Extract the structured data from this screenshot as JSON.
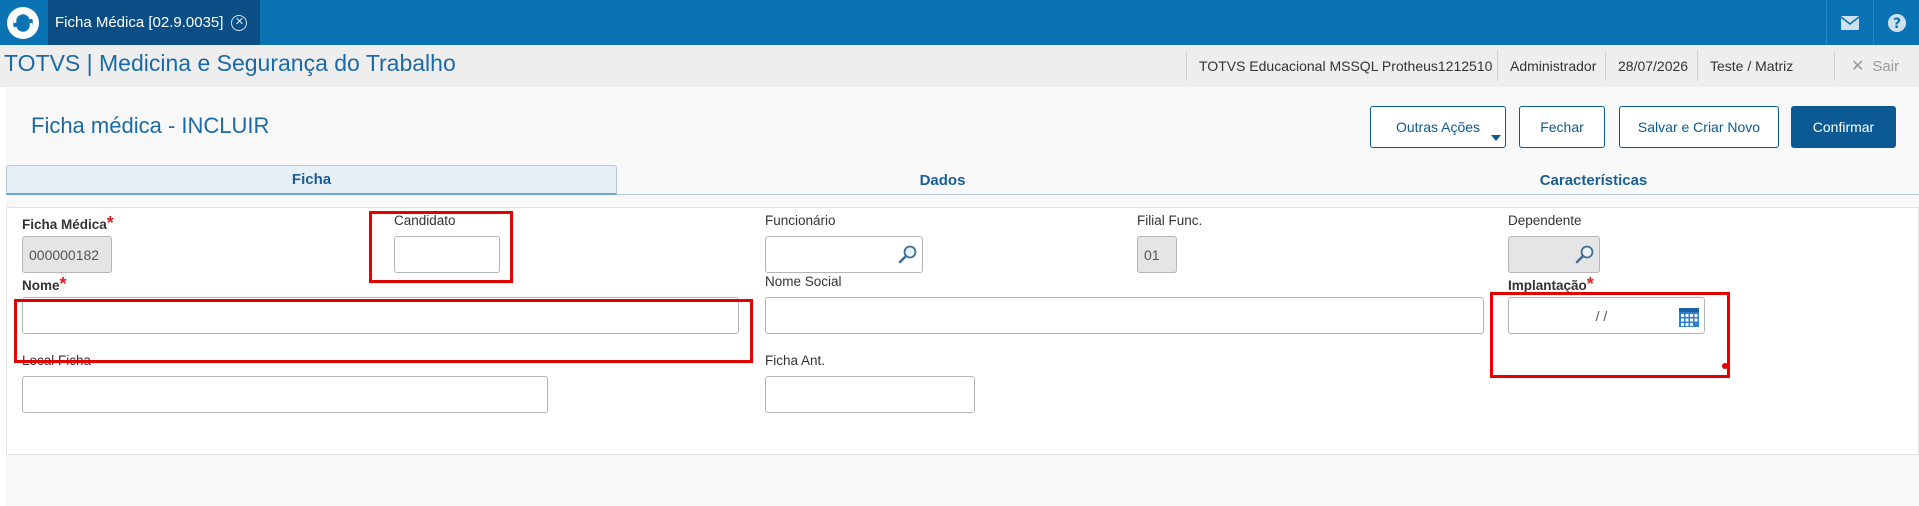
{
  "topbar": {
    "tab_label": "Ficha Médica [02.9.0035]",
    "icons": [
      "totvs-logo-icon",
      "close-icon",
      "mail-icon",
      "help-icon"
    ]
  },
  "header": {
    "app_title": "TOTVS | Medicina e Segurança do Trabalho",
    "environment": "TOTVS Educacional MSSQL Protheus1212510",
    "user": "Administrador",
    "date": "28/07/2026",
    "branch": "Teste / Matriz",
    "sair_label": "Sair"
  },
  "page": {
    "title": "Ficha médica - INCLUIR",
    "buttons": {
      "outras_acoes": "Outras Ações",
      "fechar": "Fechar",
      "salvar_criar": "Salvar e Criar Novo",
      "confirmar": "Confirmar"
    }
  },
  "tabs": [
    {
      "label": "Ficha",
      "active": true
    },
    {
      "label": "Dados",
      "active": false
    },
    {
      "label": "Características",
      "active": false
    }
  ],
  "form": {
    "ficha_medica": {
      "label": "Ficha Médica",
      "value": "000000182",
      "required": true
    },
    "candidato": {
      "label": "Candidato",
      "value": ""
    },
    "funcionario": {
      "label": "Funcionário",
      "value": ""
    },
    "filial_func": {
      "label": "Filial Func.",
      "value": "01"
    },
    "dependente": {
      "label": "Dependente",
      "value": ""
    },
    "nome": {
      "label": "Nome",
      "value": "",
      "required": true
    },
    "nome_social": {
      "label": "Nome Social",
      "value": ""
    },
    "implantacao": {
      "label": "Implantação",
      "value": "  /  /",
      "required": true
    },
    "local_ficha": {
      "label": "Local Ficha",
      "value": ""
    },
    "ficha_ant": {
      "label": "Ficha Ant.",
      "value": ""
    }
  },
  "colors": {
    "topbar": "#0a73b4",
    "active_tab": "#0b4e86",
    "accent": "#1a6aa5",
    "highlight": "#e50000"
  }
}
